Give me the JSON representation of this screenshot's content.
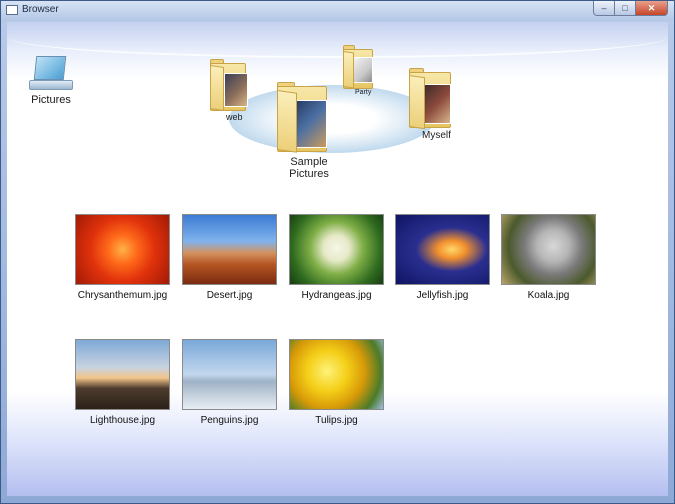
{
  "window": {
    "title": "Browser",
    "controls": {
      "minimize": "–",
      "maximize": "□",
      "close": "✕"
    }
  },
  "drive": {
    "label": "Pictures",
    "icon": "computer-drive-icon"
  },
  "folders": [
    {
      "name": "web",
      "icon": "folder-icon"
    },
    {
      "name": "Party",
      "icon": "folder-icon"
    },
    {
      "name": "Sample Pictures",
      "icon": "folder-icon"
    },
    {
      "name": "Myself",
      "icon": "folder-icon"
    }
  ],
  "photos": [
    {
      "name": "Chrysanthemum.jpg",
      "accent": "#e0320c"
    },
    {
      "name": "Desert.jpg",
      "accent": "#b45423"
    },
    {
      "name": "Hydrangeas.jpg",
      "accent": "#7fae46"
    },
    {
      "name": "Jellyfish.jpg",
      "accent": "#f2902e"
    },
    {
      "name": "Koala.jpg",
      "accent": "#7a7a7a"
    },
    {
      "name": "Lighthouse.jpg",
      "accent": "#4d3c2e"
    },
    {
      "name": "Penguins.jpg",
      "accent": "#7aa8d9"
    },
    {
      "name": "Tulips.jpg",
      "accent": "#f4cf18"
    }
  ]
}
